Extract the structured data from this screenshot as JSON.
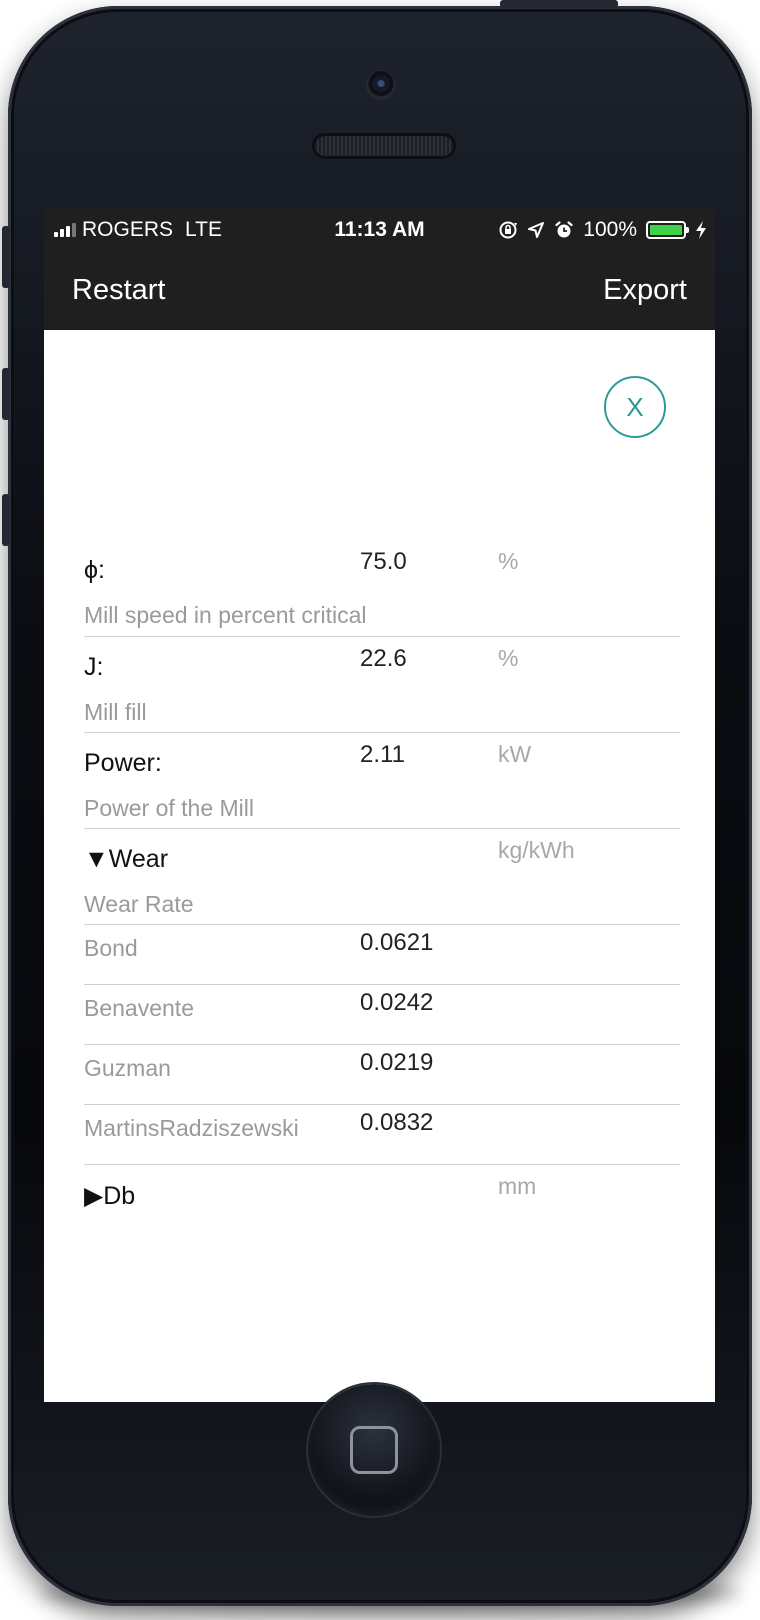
{
  "status_bar": {
    "carrier": "ROGERS",
    "network": "LTE",
    "time": "11:13 AM",
    "battery_percent": "100%",
    "battery_level": 1.0,
    "signal_bars": 3,
    "icons": [
      "orientation-lock-icon",
      "location-arrow-icon",
      "alarm-icon",
      "battery-icon",
      "charging-bolt-icon"
    ]
  },
  "nav": {
    "left_label": "Restart",
    "right_label": "Export"
  },
  "close_label": "X",
  "params": [
    {
      "label": "ϕ:",
      "value": "75.0",
      "unit": "%",
      "description": "Mill speed in percent critical"
    },
    {
      "label": "J:",
      "value": "22.6",
      "unit": "%",
      "description": "Mill fill"
    },
    {
      "label": "Power:",
      "value": "2.11",
      "unit": "kW",
      "description": "Power of the Mill"
    }
  ],
  "wear": {
    "label": "▼Wear",
    "unit": "kg/kWh",
    "description": "Wear Rate",
    "rows": [
      {
        "name": "Bond",
        "value": "0.0621"
      },
      {
        "name": "Benavente",
        "value": "0.0242"
      },
      {
        "name": "Guzman",
        "value": "0.0219"
      },
      {
        "name": "MartinsRadziszewski",
        "value": "0.0832"
      }
    ]
  },
  "db": {
    "label": "▶Db",
    "unit": "mm"
  },
  "colors": {
    "accent": "#2c9a98",
    "bar_bg": "#1f1f1f",
    "battery": "#3fd34a"
  }
}
